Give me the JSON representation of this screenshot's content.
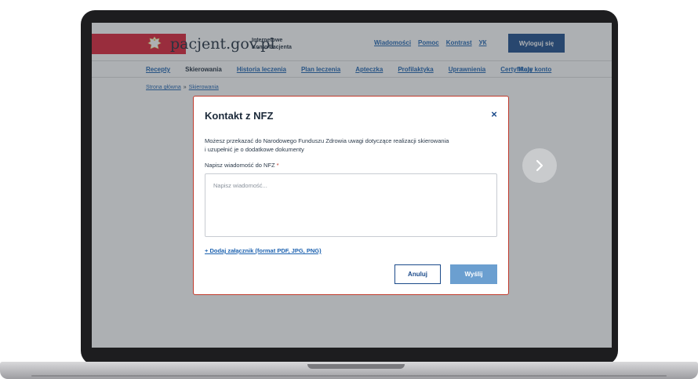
{
  "header": {
    "site_name": "pacjent.gov.pl",
    "site_sub_line1": "Internetowe",
    "site_sub_line2": "Konto Pacjenta",
    "links": [
      {
        "label": "Wiadomości"
      },
      {
        "label": "Pomoc"
      },
      {
        "label": "Kontrast"
      },
      {
        "label": "УК"
      }
    ],
    "logout_label": "Wyloguj się"
  },
  "nav": {
    "items": [
      {
        "label": "Recepty"
      },
      {
        "label": "Skierowania"
      },
      {
        "label": "Historia leczenia"
      },
      {
        "label": "Plan leczenia"
      },
      {
        "label": "Apteczka"
      },
      {
        "label": "Profilaktyka"
      },
      {
        "label": "Uprawnienia"
      },
      {
        "label": "Certyfikaty"
      }
    ],
    "account_label": "Moje konto"
  },
  "breadcrumb": {
    "home": "Strona główna",
    "separator": "»",
    "current": "Skierowania"
  },
  "modal": {
    "title": "Kontakt z NFZ",
    "close_label": "×",
    "description_line1": "Możesz przekazać do Narodowego Funduszu Zdrowia uwagi dotyczące realizacji skierowania",
    "description_line2": "i uzupełnić je o dodatkowe dokumenty",
    "field_label": "Napisz wiadomość do NFZ",
    "required_mark": "*",
    "message_value": "",
    "message_placeholder": "Napisz wiadomość...",
    "attach_label": "+ Dodaj załącznik (format PDF, JPG, PNG)",
    "cancel_label": "Anuluj",
    "send_label": "Wyślij"
  },
  "colors": {
    "flag_red": "#dc1e35",
    "primary_blue": "#1b4a8a",
    "link_blue": "#1d62b0",
    "send_button": "#6b9fd0"
  }
}
